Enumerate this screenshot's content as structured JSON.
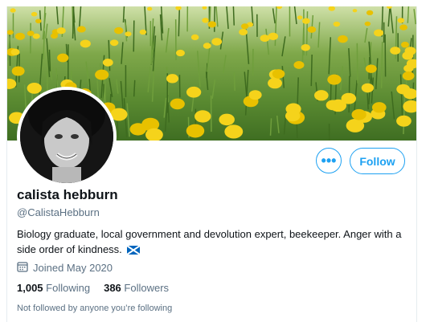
{
  "profile": {
    "display_name": "calista hebburn",
    "handle": "@CalistaHebburn",
    "bio": "Biology graduate, local government and devolution expert, beekeeper. Anger with a side order of kindness.",
    "bio_flag_icon": "scotland-flag-icon",
    "joined": "Joined May 2020",
    "following_count": "1,005",
    "following_label": "Following",
    "followers_count": "386",
    "followers_label": "Followers",
    "followed_by_note": "Not followed by anyone you’re following"
  },
  "actions": {
    "more_icon": "•••",
    "follow_label": "Follow"
  },
  "colors": {
    "accent": "#1da1f2",
    "secondary_text": "#5b7083",
    "primary_text": "#0f1419",
    "banner_green": "#5a8a31",
    "flower_yellow": "#f5d31b"
  }
}
